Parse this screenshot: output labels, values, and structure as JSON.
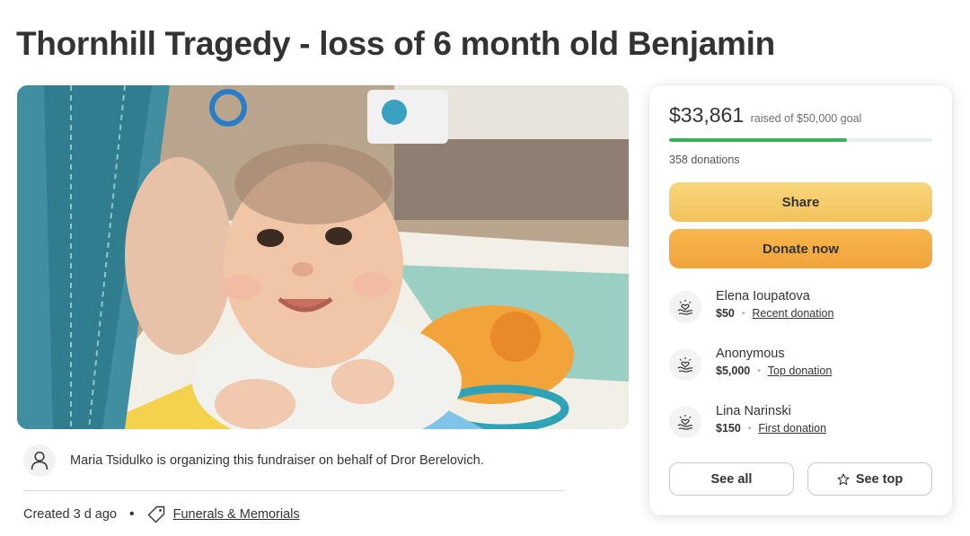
{
  "page": {
    "title": "Thornhill Tragedy - loss of 6 month old Benjamin"
  },
  "organizer": {
    "text": "Maria Tsidulko is organizing this fundraiser on behalf of Dror Berelovich.",
    "icon": "person-icon"
  },
  "meta": {
    "created": "Created 3 d ago",
    "separator": "•",
    "category_icon": "tag-icon",
    "category": "Funerals & Memorials"
  },
  "donation_card": {
    "raised": "$33,861",
    "goal_text": "raised of $50,000 goal",
    "progress_fraction": 0.677,
    "progress_color": "#3fae5a",
    "donations_count": "358 donations",
    "share_label": "Share",
    "donate_label": "Donate now",
    "donors": [
      {
        "name": "Elena Ioupatova",
        "amount": "$50",
        "tag": "Recent donation",
        "icon": "donation-hand-heart-icon"
      },
      {
        "name": "Anonymous",
        "amount": "$5,000",
        "tag": "Top donation",
        "icon": "donation-hand-heart-icon"
      },
      {
        "name": "Lina Narinski",
        "amount": "$150",
        "tag": "First donation",
        "icon": "donation-hand-heart-icon"
      }
    ],
    "separator": "•",
    "see_all_label": "See all",
    "see_top_label": "See top",
    "see_top_icon": "star-icon"
  },
  "colors": {
    "share_button": "#f3c25a",
    "donate_button": "#f0a43a",
    "text": "#333333"
  }
}
